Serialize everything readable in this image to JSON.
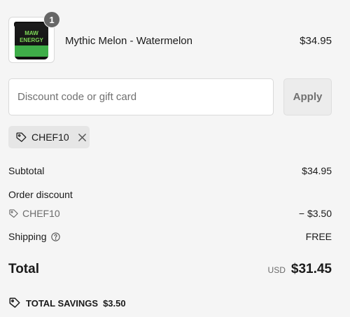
{
  "line_item": {
    "quantity": "1",
    "name": "Mythic Melon - Watermelon",
    "price": "$34.95",
    "thumb_text": "MAW ENERGY"
  },
  "discount": {
    "placeholder": "Discount code or gift card",
    "value": "",
    "apply_label": "Apply"
  },
  "applied_code": {
    "code": "CHEF10",
    "tag_icon": "tag-icon",
    "remove_icon": "close-icon"
  },
  "summary": {
    "subtotal_label": "Subtotal",
    "subtotal_value": "$34.95",
    "order_discount_label": "Order discount",
    "discount_code": "CHEF10",
    "discount_value": "− $3.50",
    "shipping_label": "Shipping",
    "shipping_value": "FREE",
    "total_label": "Total",
    "currency": "USD",
    "total_value": "$31.45",
    "savings_label": "TOTAL SAVINGS",
    "savings_value": "$3.50"
  },
  "colors": {
    "background": "#f5f5f5",
    "badge": "#666666",
    "chip": "#e6e6e6"
  }
}
